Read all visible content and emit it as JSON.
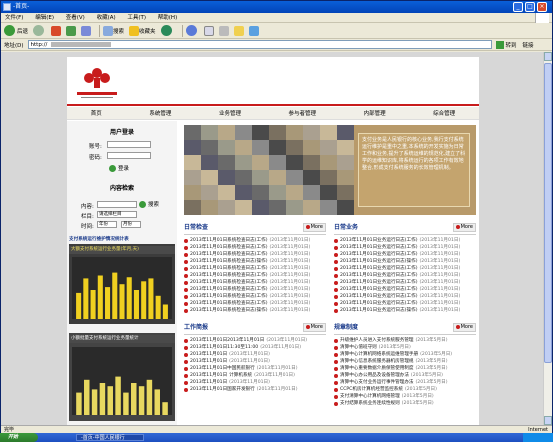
{
  "window": {
    "title": "-首页-",
    "min": "_",
    "max": "□",
    "close": "×"
  },
  "menu": [
    "文件(F)",
    "编辑(E)",
    "查看(V)",
    "收藏(A)",
    "工具(T)",
    "帮助(H)"
  ],
  "toolbar": {
    "back": "后退",
    "search": "搜索",
    "favorites": "收藏夹"
  },
  "address": {
    "label": "地址(D)",
    "value": "http://",
    "go": "转到",
    "links": "链接"
  },
  "nav": [
    "首页",
    "系统管理",
    "业务管理",
    "参与者管理",
    "内部管理",
    "综合管理"
  ],
  "login": {
    "title": "用户登录",
    "account_label": "账号:",
    "password_label": "密码:",
    "button": "登录"
  },
  "search": {
    "title": "内容检索",
    "content_label": "内容:",
    "search_btn": "搜索",
    "column_label": "栏目:",
    "column_value": "请选择栏目",
    "time_label": "时间:",
    "time_year": "年份",
    "time_month": "月份"
  },
  "charts": [
    {
      "title": "支付系统运行维护情况统计表",
      "label": "大额支付系统运行业务量(年月,天)",
      "bars": [
        0.45,
        0.7,
        0.5,
        0.75,
        0.55,
        0.8,
        0.6,
        0.72,
        0.5,
        0.65,
        0.7,
        0.4,
        0.25
      ],
      "color": "#f0d020"
    },
    {
      "title": "",
      "label": "小额批量支付系统运行业务量统计",
      "bars": [
        0.35,
        0.55,
        0.4,
        0.5,
        0.45,
        0.6,
        0.35,
        0.5,
        0.45,
        0.55,
        0.4,
        0.2
      ],
      "color": "#e8d860"
    }
  ],
  "banner": {
    "text": "支付业务是人民银行的核心业务,我行支付系统运行维护是重中之重,本系统的开发实施为日常工作和业务,提升了系统运维的规范化,建立了科学的运维知识库,将系统运行的各项工作有效地整合,形成支付系统服务的长效管理机制。"
  },
  "sections": {
    "daily_check": {
      "title": "日常检查",
      "more": "More",
      "rows": [
        [
          "2013年11月01日系统检查日志(工作)",
          "(2013年11月01日)"
        ],
        [
          "2013年11月01日系统检查日志(工作)",
          "(2013年11月01日)"
        ],
        [
          "2013年11月01日系统检查日志(工作)",
          "(2013年11月01日)"
        ],
        [
          "2013年11月01日系统检查日志(操作)",
          "(2013年11月01日)"
        ],
        [
          "2013年11月01日系统检查日志(工作)",
          "(2013年11月01日)"
        ],
        [
          "2013年11月01日系统检查日志(工作)",
          "(2013年11月01日)"
        ],
        [
          "2013年11月01日系统检查日志(工作)",
          "(2013年11月01日)"
        ],
        [
          "2013年11月01日系统检查日志(工作)",
          "(2013年11月01日)"
        ],
        [
          "2013年11月01日系统检查日志(工作)",
          "(2013年11月01日)"
        ],
        [
          "2013年11月01日系统检查日志(工作)",
          "(2013年11月01日)"
        ],
        [
          "2013年11月01日系统检查日志(操作)",
          "(2013年11月01日)"
        ]
      ]
    },
    "daily_business": {
      "title": "日常业务",
      "more": "More",
      "rows": [
        [
          "2013年11月01日业务运行日志(工作)",
          "(2013年11月01日)"
        ],
        [
          "2013年11月01日业务运行日志(工作)",
          "(2013年11月01日)"
        ],
        [
          "2013年11月01日业务运行日志(工作)",
          "(2013年11月01日)"
        ],
        [
          "2013年11月01日业务运行日志(操作)",
          "(2013年11月01日)"
        ],
        [
          "2013年11月01日业务运行日志(工作)",
          "(2013年11月01日)"
        ],
        [
          "2013年11月01日业务运行日志(工作)",
          "(2013年11月01日)"
        ],
        [
          "2013年11月01日业务运行日志(工作)",
          "(2013年11月01日)"
        ],
        [
          "2013年11月01日业务运行日志(工作)",
          "(2013年11月01日)"
        ],
        [
          "2013年11月01日业务运行日志(工作)",
          "(2013年11月01日)"
        ],
        [
          "2013年11月01日业务运行日志(工作)",
          "(2013年11月01日)"
        ],
        [
          "2013年11月01日业务运行日志(操作)",
          "(2013年11月01日)"
        ]
      ]
    },
    "work_brief": {
      "title": "工作简报",
      "more": "More",
      "rows": [
        [
          "2013年11月01日2013年11月01日",
          "(2013年11月01日)"
        ],
        [
          "2013年11月01日11:30至11:00",
          "(2013年11月01日)"
        ],
        [
          "2013年11月01日",
          "(2013年11月01日)"
        ],
        [
          "2013年11月01日",
          "(2013年11月01日)"
        ],
        [
          "2013年11月01日中国民航银行",
          "(2013年11月01日)"
        ],
        [
          "2013年11月01日",
          "计算机系统",
          "(2013年11月01日)"
        ],
        [
          "2013年11月01日",
          "(2013年11月01日)"
        ],
        [
          "2013年11月01日国家开发银行",
          "(2013年11月01日)"
        ]
      ]
    },
    "rules": {
      "title": "规章制度",
      "more": "More",
      "rows": [
        [
          "升级维护人员进入支付系统服务管理",
          "(2013年5月日)"
        ],
        [
          "清算中心值班守则",
          "(2013年5月日)"
        ],
        [
          "清算中心计算机网络系统运维管理手册",
          "(2013年5月日)"
        ],
        [
          "清算中心信息系统服务器机房管理规",
          "(2013年5月日)"
        ],
        [
          "清算中心重要数据介质保管使用制度",
          "(2013年5月日)"
        ],
        [
          "清算中心办公用品及设备管理办法",
          "(2013年5月日)"
        ],
        [
          "清算中心支付业务运行事件管理办法",
          "(2013年5月日)"
        ],
        [
          "CCPC机房计算机经营监控系统",
          "(2013年5月日)"
        ],
        [
          "支付清算中心计算机网络管理",
          "(2013年5月日)"
        ],
        [
          "支付结算系统业务连续性规则",
          "(2013年5月日)"
        ]
      ]
    }
  },
  "status": {
    "left": "完毕",
    "zone": "Internet"
  },
  "taskbar": {
    "start": "开始",
    "task": "-首页-中国人民银行",
    "clock": ""
  },
  "colors": {
    "accent": "#c81c1c",
    "link": "#1a3a8a"
  }
}
